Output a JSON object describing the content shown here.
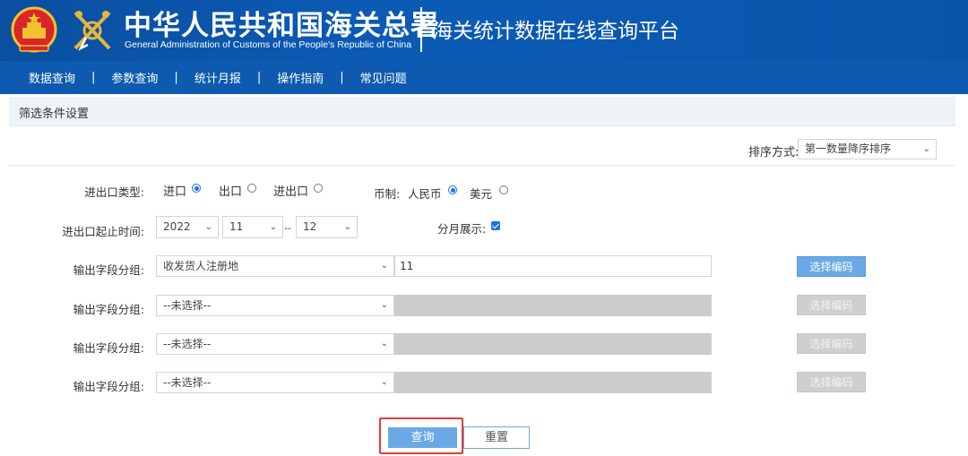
{
  "header": {
    "org_name_cn": "中华人民共和国海关总署",
    "org_name_en": "General Administration of Customs of the People's Republic of China",
    "platform_title": "海关统计数据在线查询平台"
  },
  "nav": {
    "items": [
      "数据查询",
      "参数查询",
      "统计月报",
      "操作指南",
      "常见问题"
    ],
    "separator": "|"
  },
  "panel": {
    "title": "筛选条件设置"
  },
  "sort": {
    "label": "排序方式:",
    "selected": "第一数量降序排序"
  },
  "trade_type": {
    "label": "进出口类型:",
    "options": [
      {
        "label": "进口",
        "selected": true
      },
      {
        "label": "出口",
        "selected": false
      },
      {
        "label": "进出口",
        "selected": false
      }
    ]
  },
  "currency": {
    "label": "币制:",
    "options": [
      {
        "label": "人民币",
        "selected": true
      },
      {
        "label": "美元",
        "selected": false
      }
    ]
  },
  "time_range": {
    "label": "进出口起止时间:",
    "year": "2022",
    "start_month": "11",
    "range_sep": "--",
    "end_month": "12"
  },
  "monthly_display": {
    "label": "分月展示:",
    "checked": true
  },
  "field_groups": [
    {
      "label": "输出字段分组:",
      "selected": "收发货人注册地",
      "code_value": "11",
      "button": "选择编码",
      "enabled": true
    },
    {
      "label": "输出字段分组:",
      "selected": "--未选择--",
      "code_value": "",
      "button": "选择编码",
      "enabled": false
    },
    {
      "label": "输出字段分组:",
      "selected": "--未选择--",
      "code_value": "",
      "button": "选择编码",
      "enabled": false
    },
    {
      "label": "输出字段分组:",
      "selected": "--未选择--",
      "code_value": "",
      "button": "选择编码",
      "enabled": false
    }
  ],
  "actions": {
    "query": "查询",
    "reset": "重置"
  },
  "colors": {
    "header_bg": "#0b5bb5",
    "nav_bg": "#0d5ab0",
    "primary_button": "#6aa9e6",
    "highlight": "#e23a3a"
  }
}
